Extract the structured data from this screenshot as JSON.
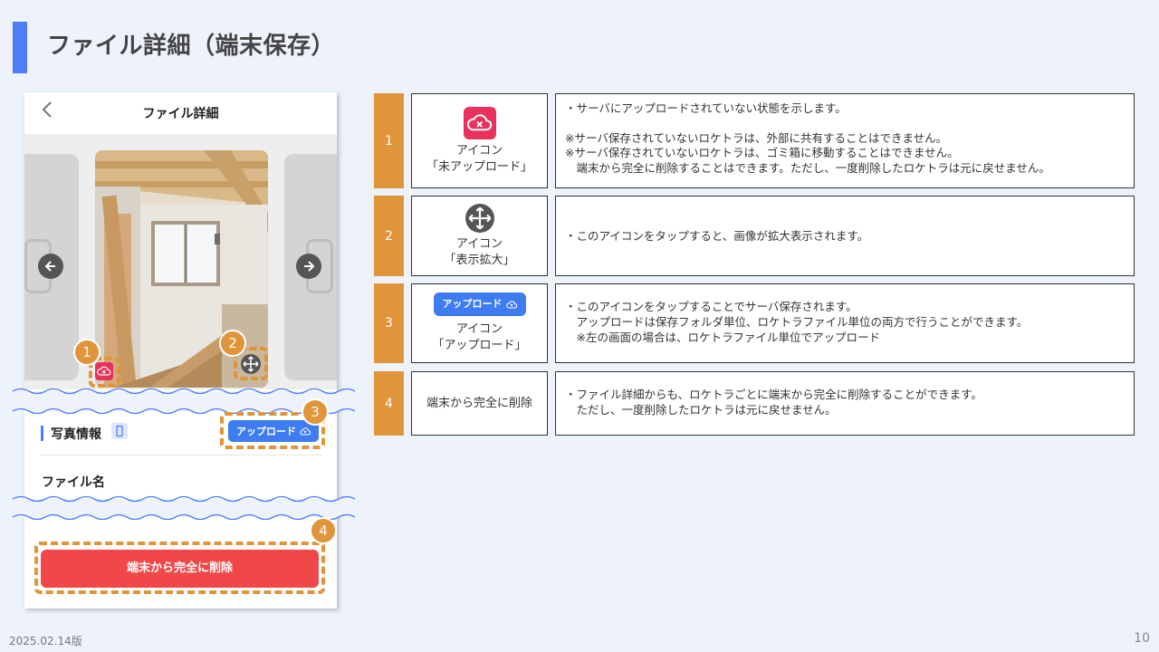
{
  "page": {
    "title": "ファイル詳細（端末保存）",
    "date": "2025.02.14版",
    "page_number": "10",
    "accent": "#4f7cf7",
    "highlight": "#e0953a"
  },
  "phone": {
    "header_title": "ファイル詳細",
    "back_icon": "chevron-left-icon",
    "section_title": "写真情報",
    "upload_label": "アップロード",
    "filename_label": "ファイル名",
    "delete_label": "端末から完全に削除"
  },
  "callouts": [
    "1",
    "2",
    "3",
    "4"
  ],
  "rows": [
    {
      "num": "1",
      "icon_name": "cloud-x-icon",
      "label_line1": "アイコン",
      "label_line2": "「未アップロード」",
      "desc": [
        "・サーバにアップロードされていない状態を示します。",
        "",
        "※サーバ保存されていないロケトラは、外部に共有することはできません。",
        "※サーバ保存されていないロケトラは、ゴミ箱に移動することはできません。",
        "　端末から完全に削除することはできます。ただし、一度削除したロケトラは元に戻せません。"
      ]
    },
    {
      "num": "2",
      "icon_name": "expand-arrows-icon",
      "label_line1": "アイコン",
      "label_line2": "「表示拡大」",
      "desc": [
        "・このアイコンをタップすると、画像が拡大表示されます。"
      ]
    },
    {
      "num": "3",
      "icon_name": "upload-button-icon",
      "button_label": "アップロード",
      "label_line1": "アイコン",
      "label_line2": "「アップロード」",
      "desc": [
        "・このアイコンをタップすることでサーバ保存されます。",
        "　アップロードは保存フォルダ単位、ロケトラファイル単位の両方で行うことができます。",
        "　※左の画面の場合は、ロケトラファイル単位でアップロード"
      ]
    },
    {
      "num": "4",
      "label_line1": "端末から完全に削除",
      "desc": [
        "・ファイル詳細からも、ロケトラごとに端末から完全に削除することができます。",
        "　ただし、一度削除したロケトラは元に戻せません。"
      ]
    }
  ]
}
